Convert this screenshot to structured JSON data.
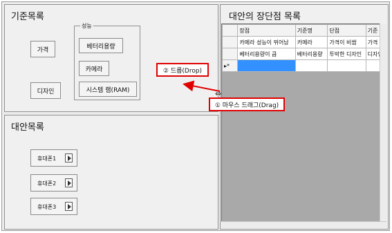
{
  "criteria_panel": {
    "title": "기준목록"
  },
  "criteria": {
    "price": "가격",
    "design": "디자인",
    "performance_group": {
      "label": "성능",
      "items": [
        "베터리용량",
        "카메라",
        "시스템 램(RAM)"
      ]
    }
  },
  "alternatives_panel": {
    "title": "대안목록",
    "phones": [
      "휴대폰1",
      "휴대폰2",
      "휴대폰3"
    ]
  },
  "pros_cons_panel": {
    "title": "대안의 장단점 목록",
    "columns": [
      "장점",
      "기준명",
      "단점",
      "기준"
    ],
    "rows": [
      [
        "카메라 성능이 뛰어남",
        "카메라",
        "가격이 비쌈",
        "가격"
      ],
      [
        "베터리용량이 큼",
        "베터리용량",
        "투박한 디자인",
        "디자인"
      ]
    ],
    "new_row_marker": "▸*"
  },
  "annotations": {
    "drop": "② 드롭(Drop)",
    "drag": "① 마우스 드래그(Drag)"
  },
  "colors": {
    "annotation_border": "#e00000",
    "selection": "#3390ff",
    "grid_background": "#a9a9a9"
  }
}
